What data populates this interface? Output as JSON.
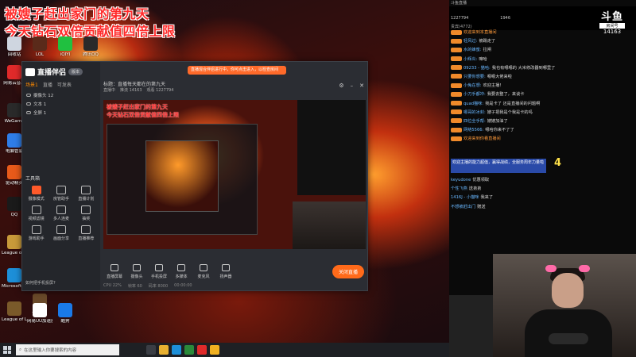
{
  "desktop": {
    "banner_line1": "被嫂子赶出家门的第九天",
    "banner_line2": "今天钻石双倍贡献值四倍上限",
    "icons": [
      {
        "label": "回收站",
        "color": "#cfd6e0"
      },
      {
        "label": "网易云音乐",
        "color": "#e02a2a"
      },
      {
        "label": "WeGame",
        "color": "#2a2a2a"
      },
      {
        "label": "电脑管家",
        "color": "#2f7de8"
      },
      {
        "label": "驱动精灵",
        "color": "#e85a1a"
      },
      {
        "label": "QQ",
        "color": "#1a1a1a"
      },
      {
        "label": "League of Legends",
        "color": "#c89a3a"
      },
      {
        "label": "Microsoft Edge",
        "color": "#1d8fd8"
      },
      {
        "label": "League of Legends",
        "color": "#7a5a2a"
      },
      {
        "label": "LOL",
        "color": "#5a2a1a"
      },
      {
        "label": "iQIYI",
        "color": "#20c040"
      },
      {
        "label": "腾讯QQ",
        "color": "#2a2a2a"
      },
      {
        "label": "Animal",
        "color": "#6a4a2a"
      },
      {
        "label": "网易UU加速器",
        "color": "#ffffff"
      },
      {
        "label": "酷狗",
        "color": "#1a7ae8"
      }
    ]
  },
  "app": {
    "logo": "直播伴侣",
    "logo_pill": "版本",
    "scene_tabs": [
      "场景1",
      "直播",
      "可发表"
    ],
    "sources": [
      {
        "label": "摄像头 12"
      },
      {
        "label": "文本 1"
      },
      {
        "label": "全屏 1"
      }
    ],
    "tools_label": "工具箱",
    "tools": [
      "摄像模式",
      "房管助手",
      "直播计划",
      "视频滤镜",
      "多人连麦",
      "抽奖",
      "游戏助手",
      "画面分享",
      "直播推荐"
    ],
    "sidebar_note": "如何把手机投屏?",
    "title_text": "标题：直播每天都在的第九天",
    "toast": "直播混合伴侣进行中，你可点击进入，以检查房间",
    "status": [
      "直播中",
      "推流 14163",
      "观看 1227794"
    ],
    "bottom_tools": [
      "直播屏幕",
      "摄像头",
      "手机投屏",
      "多媒体",
      "麦克风",
      "扬声器"
    ],
    "live_button": "关闭直播",
    "footer": [
      "CPU 22%",
      "帧率 60",
      "码率 8000",
      "00:00:00"
    ],
    "preview_banner1": "被嫂子赶出家门的第九天",
    "preview_banner2": "今天钻石双倍贡献值四倍上限"
  },
  "taskbar": {
    "search_placeholder": "在这里输入你要搜索的内容",
    "clock": ""
  },
  "stream": {
    "top_bar": "斗鱼直播",
    "viewers": "1227794",
    "follows": "1946",
    "tab": "贵宾(4772)",
    "logo": "斗鱼",
    "logo_sub": "房间号",
    "room_id": "14163",
    "chat": [
      {
        "name": "欢迎来到本直播间",
        "text": "",
        "warm": true
      },
      {
        "name": "轻风过:",
        "text": "被踢走了",
        "warm": false
      },
      {
        "name": "水的蜂蜜:",
        "text": "拉闸",
        "warm": false
      },
      {
        "name": "小辉炎:",
        "text": "嘛哈",
        "warm": false
      },
      {
        "name": "09233 - 猫哈:",
        "text": "我也有嗯嗯的 大米修改器到哪里了",
        "warm": false
      },
      {
        "name": "只要你想要:",
        "text": "嗯嗯大佬来啦",
        "warm": false
      },
      {
        "name": "小兔在想:",
        "text": "欢迎主播！",
        "warm": false
      },
      {
        "name": "小刀手都冲:",
        "text": "我要去整了，来谈卡",
        "warm": false
      },
      {
        "name": "quad猫咪:",
        "text": "我是卡了 还是直播间的问题啊",
        "warm": false
      },
      {
        "name": "嗯哥的冰封:",
        "text": "嫂子把我是个我是卡的吗",
        "warm": false
      },
      {
        "name": "四位全手帮:",
        "text": "嫂嫂加油了",
        "warm": false
      },
      {
        "name": "网络5566:",
        "text": "嗯哈你来不了了",
        "warm": false
      },
      {
        "name": "欢迎来到你看直播间",
        "text": "",
        "warm": true
      }
    ],
    "banner_text": "欢迎主播的能力超值，赢得战绩，全服务周年力量啦",
    "badge": "4",
    "chat2": [
      {
        "name": "keyudone",
        "text": "优惠领取"
      },
      {
        "name": "个性飞燕",
        "text": "送弟弟"
      },
      {
        "name": "1416J - 小猫咪",
        "text": "我来了"
      },
      {
        "name": "不想被赶出门",
        "text": "赠送"
      }
    ]
  }
}
